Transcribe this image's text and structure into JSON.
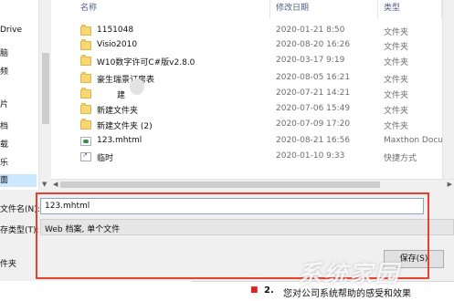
{
  "nav": {
    "items": [
      {
        "label": "Drive",
        "selected": false
      },
      {
        "label": "脑",
        "selected": false
      },
      {
        "label": "频",
        "selected": false
      },
      {
        "label": "片",
        "selected": false
      },
      {
        "label": "档",
        "selected": false
      },
      {
        "label": "载",
        "selected": false
      },
      {
        "label": "乐",
        "selected": false
      },
      {
        "label": "面",
        "selected": true
      }
    ]
  },
  "list": {
    "headers": {
      "name": "名称",
      "date": "修改日期",
      "type": "类型"
    },
    "rows": [
      {
        "icon": "folder-icon",
        "name": "1151048",
        "date": "2020-01-21 8:50",
        "type": "文件夹"
      },
      {
        "icon": "folder-icon",
        "name": "Visio2010",
        "date": "2020-08-20 16:26",
        "type": "文件夹"
      },
      {
        "icon": "folder-icon",
        "name": "W10数字许可C#版v2.8.0",
        "date": "2020-03-17 9:19",
        "type": "文件夹"
      },
      {
        "icon": "folder-icon",
        "name": "豪生瑞景订房表",
        "date": "2020-08-05 16:21",
        "type": "文件夹"
      },
      {
        "icon": "folder-icon",
        "name": "建",
        "date": "2020-07-21 14:21",
        "type": "文件夹"
      },
      {
        "icon": "folder-icon",
        "name": "新建文件夹",
        "date": "2020-07-06 15:49",
        "type": "文件夹"
      },
      {
        "icon": "folder-icon",
        "name": "新建文件夹 (2)",
        "date": "2020-07-09 17:20",
        "type": "文件夹"
      },
      {
        "icon": "file-icon",
        "name": "123.mhtml",
        "date": "2020-08-21 16:56",
        "type": "Maxthon Document"
      },
      {
        "icon": "shortcut-icon",
        "name": "临时",
        "date": "2020-01-10 9:33",
        "type": "快捷方式"
      }
    ]
  },
  "form": {
    "filename_label": "文件名(N):",
    "filename_value": "123.mhtml",
    "savetype_label": "存类型(T):",
    "savetype_value": "Web 档案, 单个文件",
    "hide_label": "件夹",
    "save_button": "保存(S)"
  },
  "document": {
    "marker": "■",
    "number": "2.",
    "text": "您对公司系统帮助的感受和效果"
  },
  "watermark": "系统家园",
  "colors": {
    "highlight_box": "#e8402f",
    "selection": "#cce8ff",
    "folder": "#f7d774"
  }
}
